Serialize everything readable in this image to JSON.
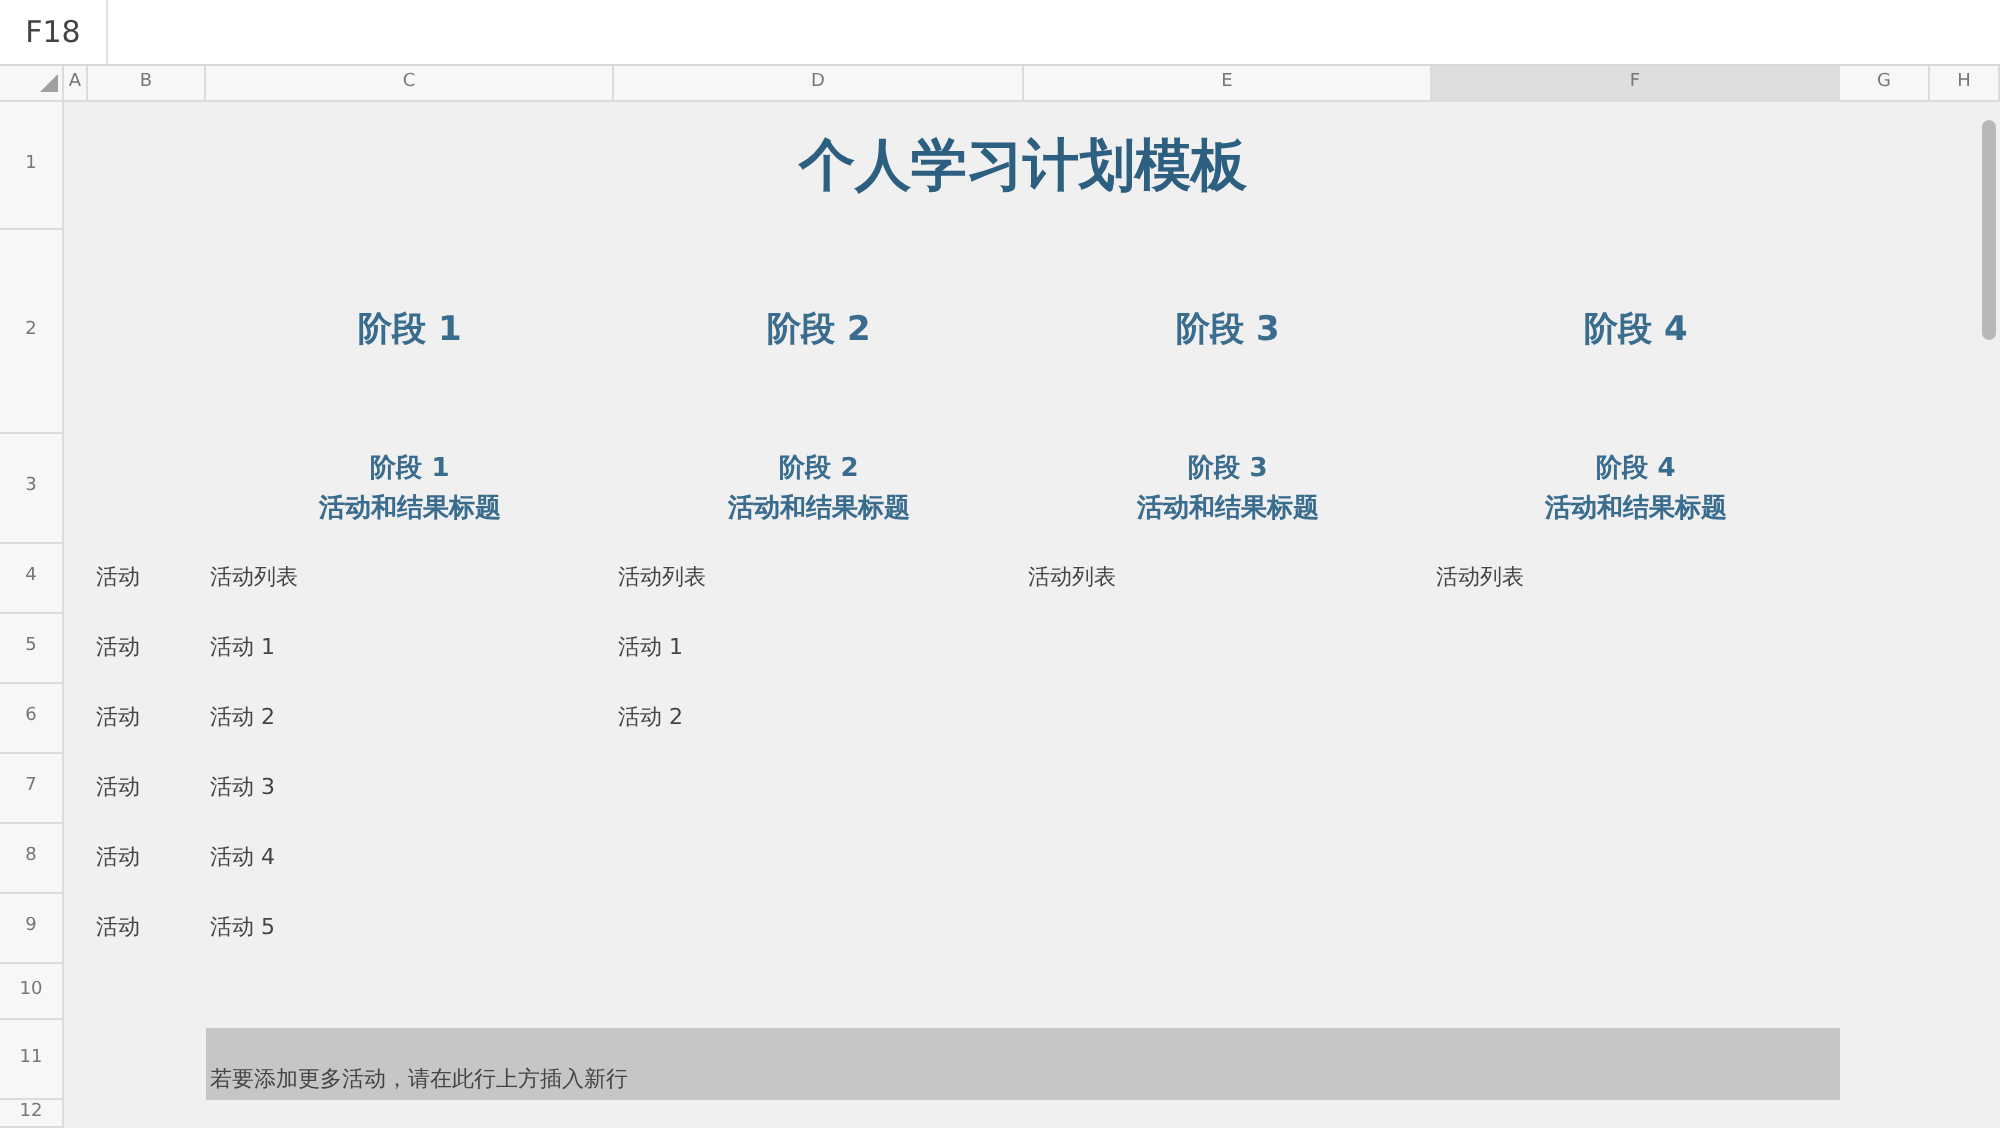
{
  "name_box": "F18",
  "columns": [
    {
      "label": "A",
      "selected": false
    },
    {
      "label": "B",
      "selected": false
    },
    {
      "label": "C",
      "selected": false
    },
    {
      "label": "D",
      "selected": false
    },
    {
      "label": "E",
      "selected": false
    },
    {
      "label": "F",
      "selected": true
    },
    {
      "label": "G",
      "selected": false
    },
    {
      "label": "H",
      "selected": false
    }
  ],
  "rows": [
    "1",
    "2",
    "3",
    "4",
    "5",
    "6",
    "7",
    "8",
    "9",
    "10",
    "11",
    "12"
  ],
  "sheet": {
    "title": "个人学习计划模板",
    "stages": [
      "阶段 1",
      "阶段 2",
      "阶段 3",
      "阶段 4"
    ],
    "stage_headers": [
      {
        "stage": "阶段 1",
        "subtitle": "活动和结果标题"
      },
      {
        "stage": "阶段 2",
        "subtitle": "活动和结果标题"
      },
      {
        "stage": "阶段 3",
        "subtitle": "活动和结果标题"
      },
      {
        "stage": "阶段 4",
        "subtitle": "活动和结果标题"
      }
    ],
    "activity_labels": [
      "活动",
      "活动",
      "活动",
      "活动",
      "活动",
      "活动"
    ],
    "activity_columns": [
      [
        "活动列表",
        "活动 1",
        "活动 2",
        "活动 3",
        "活动 4",
        "活动 5"
      ],
      [
        "活动列表",
        "活动 1",
        "活动 2"
      ],
      [
        "活动列表"
      ],
      [
        "活动列表"
      ]
    ],
    "note": "若要添加更多活动，请在此行上方插入新行"
  }
}
